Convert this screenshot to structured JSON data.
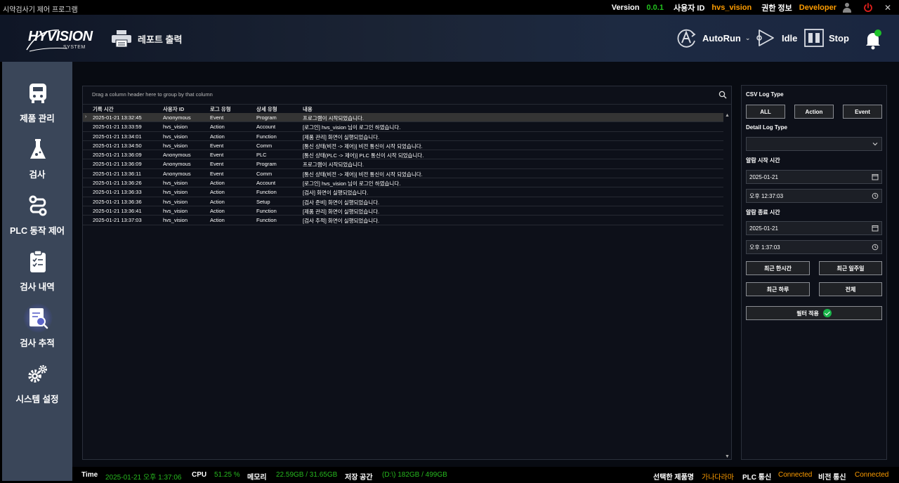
{
  "titlebar": {
    "app_title": "시약검사기 제어 프로그램",
    "version_label": "Version",
    "version_value": "0.0.1",
    "user_id_label": "사용자 ID",
    "user_id_value": "hvs_vision",
    "permission_label": "권한 정보",
    "permission_value": "Developer",
    "close": "✕"
  },
  "header": {
    "logo_text": "HYVISION",
    "logo_sub": "SYSTEM",
    "report_label": "레포트 출력",
    "autorun_label": "AutoRun",
    "idle_label": "Idle",
    "stop_label": "Stop"
  },
  "sidebar": {
    "items": [
      {
        "label": "제품 관리",
        "icon": "product-icon"
      },
      {
        "label": "검사",
        "icon": "flask-icon"
      },
      {
        "label": "PLC 동작 제어",
        "icon": "plc-icon"
      },
      {
        "label": "검사 내역",
        "icon": "clipboard-icon"
      },
      {
        "label": "검사 추적",
        "icon": "trace-search-icon"
      },
      {
        "label": "시스템 설정",
        "icon": "gears-icon"
      }
    ],
    "active_index": 4
  },
  "grid": {
    "group_hint": "Drag a column header here to group by that column",
    "columns": [
      "기록 시간",
      "사용자 ID",
      "로그 유형",
      "상세 유형",
      "내용"
    ],
    "rows": [
      [
        "2025-01-21 13:32:45",
        "Anonymous",
        "Event",
        "Program",
        "프로그램이 시작되었습니다."
      ],
      [
        "2025-01-21 13:33:59",
        "hvs_vision",
        "Action",
        "Account",
        "[로그인] hvs_vision 님이 로그인 하였습니다."
      ],
      [
        "2025-01-21 13:34:01",
        "hvs_vision",
        "Action",
        "Function",
        "[제품 관리] 화면이 실행되었습니다."
      ],
      [
        "2025-01-21 13:34:50",
        "hvs_vision",
        "Event",
        "Comm",
        "[통신 상태(비전 -> 제어)] 비전 통신이 시작 되었습니다."
      ],
      [
        "2025-01-21 13:36:09",
        "Anonymous",
        "Event",
        "PLC",
        "[통신 상태(PLC -> 제어)] PLC 통신이 시작 되었습니다."
      ],
      [
        "2025-01-21 13:36:09",
        "Anonymous",
        "Event",
        "Program",
        "프로그램이 시작되었습니다."
      ],
      [
        "2025-01-21 13:36:11",
        "Anonymous",
        "Event",
        "Comm",
        "[통신 상태(비전 -> 제어)] 비전 통신이 시작 되었습니다."
      ],
      [
        "2025-01-21 13:36:26",
        "hvs_vision",
        "Action",
        "Account",
        "[로그인] hvs_vision 님이 로그인 하였습니다."
      ],
      [
        "2025-01-21 13:36:33",
        "hvs_vision",
        "Action",
        "Function",
        "[검사] 화면이 실행되었습니다."
      ],
      [
        "2025-01-21 13:36:36",
        "hvs_vision",
        "Action",
        "Setup",
        "[검사 준비] 화면이 실행되었습니다."
      ],
      [
        "2025-01-21 13:36:41",
        "hvs_vision",
        "Action",
        "Function",
        "[제품 관리] 화면이 실행되었습니다."
      ],
      [
        "2025-01-21 13:37:03",
        "hvs_vision",
        "Action",
        "Function",
        "[검사 추적] 화면이 실행되었습니다."
      ]
    ]
  },
  "filter": {
    "csv_log_type_label": "CSV Log Type",
    "btn_all": "ALL",
    "btn_action": "Action",
    "btn_event": "Event",
    "detail_log_type_label": "Detail Log Type",
    "detail_log_type_value": "",
    "start_label": "알람 시작 시간",
    "start_date": "2025-01-21",
    "start_time": "오후 12:37:03",
    "end_label": "알람 종료 시간",
    "end_date": "2025-01-21",
    "end_time": "오후 1:37:03",
    "btn_last_hour": "최근 한시간",
    "btn_last_week": "최근 일주일",
    "btn_last_day": "최근 하루",
    "btn_all_range": "전체",
    "btn_apply": "필터 적용"
  },
  "statusbar": {
    "time_label": "Time",
    "time_value": "2025-01-21 오후 1:37:06",
    "cpu_label": "CPU",
    "cpu_value": "51.25 %",
    "memory_label": "메모리",
    "memory_value": "22.59GB / 31.65GB",
    "storage_label": "저장 공간",
    "storage_value": "(D:\\) 182GB / 499GB",
    "product_label": "선택한 제품명",
    "product_value": "가나다라마",
    "plc_label": "PLC 통신",
    "plc_value": "Connected",
    "vision_label": "비전 통신",
    "vision_value": "Connected"
  },
  "colors": {
    "accent_green": "#22c01e",
    "accent_orange": "#ff9d00",
    "sidebar_bg": "#3a4659",
    "power_red": "#e0201c"
  }
}
